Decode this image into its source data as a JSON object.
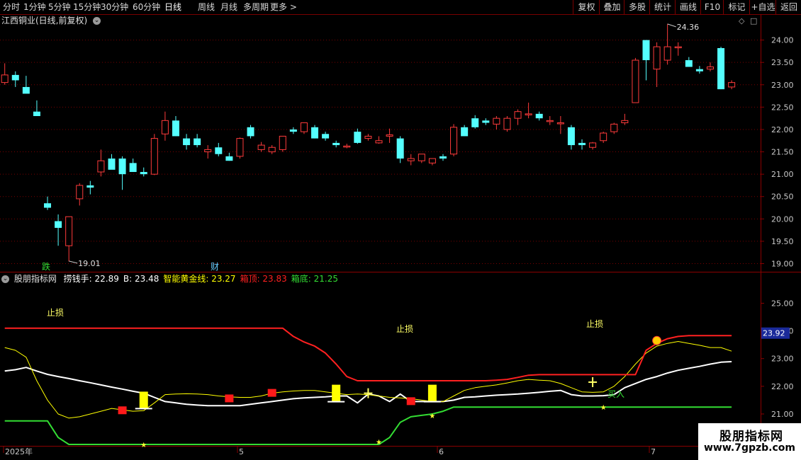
{
  "toolbar": {
    "periods": [
      "分时",
      "1分钟",
      "5分钟",
      "15分钟",
      "30分钟",
      "60分钟",
      "日线",
      "周线",
      "月线",
      "多周期",
      "更多 >"
    ],
    "active_period": "日线",
    "buttons": [
      "复权",
      "叠加",
      "多股",
      "统计",
      "画线",
      "F10",
      "标记",
      "+自选",
      "返回"
    ]
  },
  "main_panel": {
    "title": "江西铜业(日线,前复权)",
    "high_label": "24.36",
    "low_label": "19.01",
    "markers": [
      {
        "text": "跌",
        "color": "#33dd33"
      },
      {
        "text": "财",
        "color": "#66ccff"
      }
    ]
  },
  "indicator_panel": {
    "title": "股朋指标网",
    "legend": [
      {
        "label": "捞钱手:",
        "value": "22.89",
        "color": "#ffffff"
      },
      {
        "label": "B:",
        "value": "23.48",
        "color": "#ffffff"
      },
      {
        "label": "智能黄金线:",
        "value": "23.27",
        "color": "#ffff00"
      },
      {
        "label": "箱顶:",
        "value": "23.83",
        "color": "#ff2020"
      },
      {
        "label": "箱底:",
        "value": "21.25",
        "color": "#33dd33"
      }
    ],
    "annotations": [
      {
        "text": "止损",
        "color": "#ffff66"
      },
      {
        "text": "止损",
        "color": "#ffff66"
      },
      {
        "text": "止损",
        "color": "#ffff66"
      },
      {
        "text": "买入",
        "color": "#33dd33"
      }
    ],
    "current_value": "23.92"
  },
  "xaxis": {
    "labels": [
      "2025年",
      "5",
      "6",
      "7"
    ]
  },
  "watermark": {
    "line1": "股朋指标网",
    "line2": "www.7gpzb.com"
  },
  "chart_data": [
    {
      "type": "candlestick",
      "title": "江西铜业(日线,前复权)",
      "ylim": [
        18.85,
        24.5
      ],
      "yticks": [
        19.0,
        19.5,
        20.0,
        20.5,
        21.0,
        21.5,
        22.0,
        22.5,
        23.0,
        23.5,
        24.0
      ],
      "ohlc": [
        [
          23.05,
          23.48,
          23.0,
          23.22
        ],
        [
          23.22,
          23.3,
          22.95,
          23.1
        ],
        [
          22.95,
          23.2,
          22.9,
          22.8
        ],
        [
          22.4,
          22.65,
          22.3,
          22.3
        ],
        [
          20.35,
          20.5,
          20.2,
          20.25
        ],
        [
          19.95,
          20.1,
          19.4,
          19.8
        ],
        [
          19.4,
          20.05,
          19.05,
          20.05
        ],
        [
          20.45,
          20.8,
          20.3,
          20.75
        ],
        [
          20.75,
          20.85,
          20.55,
          20.7
        ],
        [
          21.05,
          21.55,
          20.95,
          21.3
        ],
        [
          21.35,
          21.45,
          21.15,
          21.1
        ],
        [
          21.35,
          21.4,
          20.65,
          21.0
        ],
        [
          21.25,
          21.35,
          21.05,
          21.05
        ],
        [
          21.05,
          21.15,
          20.95,
          21.0
        ],
        [
          21.0,
          21.9,
          20.98,
          21.8
        ],
        [
          21.9,
          22.4,
          21.75,
          22.2
        ],
        [
          22.2,
          22.3,
          21.85,
          21.85
        ],
        [
          21.8,
          21.9,
          21.55,
          21.65
        ],
        [
          21.8,
          21.9,
          21.6,
          21.65
        ],
        [
          21.5,
          21.65,
          21.35,
          21.55
        ],
        [
          21.6,
          21.7,
          21.4,
          21.45
        ],
        [
          21.4,
          21.48,
          21.3,
          21.3
        ],
        [
          21.4,
          21.82,
          21.35,
          21.8
        ],
        [
          22.05,
          22.1,
          21.8,
          21.85
        ],
        [
          21.55,
          21.72,
          21.5,
          21.65
        ],
        [
          21.5,
          21.65,
          21.45,
          21.6
        ],
        [
          21.55,
          21.85,
          21.5,
          21.85
        ],
        [
          22.0,
          22.05,
          21.9,
          21.95
        ],
        [
          21.95,
          22.15,
          21.9,
          22.15
        ],
        [
          22.05,
          22.1,
          21.8,
          21.8
        ],
        [
          21.9,
          21.95,
          21.75,
          21.8
        ],
        [
          21.7,
          21.75,
          21.6,
          21.65
        ],
        [
          21.62,
          21.68,
          21.58,
          21.63
        ],
        [
          21.95,
          22.02,
          21.68,
          21.7
        ],
        [
          21.8,
          21.9,
          21.75,
          21.85
        ],
        [
          21.7,
          21.85,
          21.68,
          21.75
        ],
        [
          21.85,
          22.02,
          21.7,
          21.88
        ],
        [
          21.8,
          21.85,
          21.25,
          21.35
        ],
        [
          21.3,
          21.45,
          21.2,
          21.35
        ],
        [
          21.3,
          21.45,
          21.25,
          21.45
        ],
        [
          21.25,
          21.35,
          21.2,
          21.35
        ],
        [
          21.4,
          21.45,
          21.3,
          21.35
        ],
        [
          21.45,
          22.12,
          21.4,
          22.05
        ],
        [
          22.05,
          22.1,
          21.85,
          21.85
        ],
        [
          22.25,
          22.32,
          22.02,
          22.05
        ],
        [
          22.2,
          22.25,
          22.1,
          22.15
        ],
        [
          22.12,
          22.3,
          22.0,
          22.25
        ],
        [
          22.0,
          22.3,
          21.95,
          22.25
        ],
        [
          22.25,
          22.45,
          22.1,
          22.4
        ],
        [
          22.35,
          22.6,
          22.25,
          22.35
        ],
        [
          22.35,
          22.4,
          22.2,
          22.25
        ],
        [
          22.2,
          22.3,
          22.1,
          22.2
        ],
        [
          22.15,
          22.3,
          21.9,
          22.15
        ],
        [
          22.05,
          22.1,
          21.55,
          21.65
        ],
        [
          21.7,
          21.78,
          21.55,
          21.65
        ],
        [
          21.6,
          21.72,
          21.55,
          21.7
        ],
        [
          21.75,
          21.95,
          21.7,
          21.92
        ],
        [
          21.95,
          22.15,
          21.9,
          22.12
        ],
        [
          22.15,
          22.35,
          22.1,
          22.2
        ],
        [
          22.6,
          23.6,
          22.6,
          23.55
        ],
        [
          24.0,
          24.0,
          23.1,
          23.55
        ],
        [
          23.35,
          23.95,
          22.95,
          23.85
        ],
        [
          23.55,
          24.36,
          23.45,
          23.85
        ],
        [
          23.85,
          23.95,
          23.65,
          23.85
        ],
        [
          23.55,
          23.62,
          23.4,
          23.4
        ],
        [
          23.35,
          23.42,
          23.25,
          23.3
        ],
        [
          23.35,
          23.5,
          23.3,
          23.4
        ],
        [
          23.82,
          23.85,
          22.9,
          22.9
        ],
        [
          22.95,
          23.1,
          22.9,
          23.05
        ]
      ]
    },
    {
      "type": "line",
      "title": "股朋指标网",
      "ylim": [
        19.9,
        25.6
      ],
      "yticks": [
        20.0,
        21.0,
        22.0,
        23.0,
        24.0,
        25.0
      ],
      "x": [
        0,
        1,
        2,
        3,
        4,
        5,
        6,
        7,
        8,
        9,
        10,
        11,
        12,
        13,
        14,
        15,
        16,
        17,
        18,
        19,
        20,
        21,
        22,
        23,
        24,
        25,
        26,
        27,
        28,
        29,
        30,
        31,
        32,
        33,
        34,
        35,
        36,
        37,
        38,
        39,
        40,
        41,
        42,
        43,
        44,
        45,
        46,
        47,
        48,
        49,
        50,
        51,
        52,
        53,
        54,
        55,
        56,
        57,
        58,
        59,
        60,
        61,
        62,
        63,
        64,
        65,
        66,
        67,
        68
      ],
      "series": [
        {
          "name": "捞钱手",
          "color": "#ffffff",
          "values": [
            22.55,
            22.6,
            22.68,
            22.55,
            22.43,
            22.35,
            22.28,
            22.2,
            22.13,
            22.05,
            21.97,
            21.9,
            21.82,
            21.75,
            21.6,
            21.45,
            21.4,
            21.35,
            21.32,
            21.3,
            21.3,
            21.3,
            21.3,
            21.35,
            21.4,
            21.45,
            21.5,
            21.55,
            21.58,
            21.6,
            21.62,
            21.65,
            21.65,
            21.4,
            21.72,
            21.65,
            21.45,
            21.72,
            21.45,
            21.45,
            21.45,
            21.45,
            21.5,
            21.6,
            21.62,
            21.65,
            21.68,
            21.7,
            21.72,
            21.75,
            21.78,
            21.82,
            21.85,
            21.7,
            21.65,
            21.65,
            21.66,
            21.7,
            21.95,
            22.1,
            22.25,
            22.35,
            22.48,
            22.58,
            22.65,
            22.72,
            22.8,
            22.87,
            22.89
          ]
        },
        {
          "name": "智能黄金线",
          "color": "#ffff00",
          "values": [
            23.4,
            23.3,
            23.05,
            22.2,
            21.5,
            21.0,
            20.85,
            20.9,
            21.0,
            21.1,
            21.2,
            21.15,
            21.1,
            21.12,
            21.4,
            21.7,
            21.72,
            21.73,
            21.72,
            21.7,
            21.65,
            21.62,
            21.6,
            21.6,
            21.65,
            21.75,
            21.8,
            21.83,
            21.85,
            21.85,
            21.8,
            21.75,
            21.7,
            21.72,
            21.7,
            21.65,
            21.6,
            21.58,
            21.55,
            21.5,
            21.45,
            21.45,
            21.65,
            21.85,
            21.95,
            22.0,
            22.05,
            22.12,
            22.2,
            22.25,
            22.22,
            22.2,
            22.1,
            21.95,
            21.8,
            21.78,
            21.8,
            22.0,
            22.35,
            22.8,
            23.2,
            23.45,
            23.55,
            23.62,
            23.55,
            23.48,
            23.4,
            23.4,
            23.27
          ]
        },
        {
          "name": "箱顶",
          "color": "#ff2020",
          "values": [
            24.1,
            24.1,
            24.1,
            24.1,
            24.1,
            24.1,
            24.1,
            24.1,
            24.1,
            24.1,
            24.1,
            24.1,
            24.1,
            24.1,
            24.1,
            24.1,
            24.1,
            24.1,
            24.1,
            24.1,
            24.1,
            24.1,
            24.1,
            24.1,
            24.1,
            24.1,
            24.1,
            23.8,
            23.6,
            23.45,
            23.2,
            22.8,
            22.35,
            22.2,
            22.2,
            22.2,
            22.2,
            22.2,
            22.2,
            22.2,
            22.2,
            22.2,
            22.2,
            22.2,
            22.2,
            22.2,
            22.22,
            22.25,
            22.32,
            22.4,
            22.42,
            22.42,
            22.42,
            22.42,
            22.42,
            22.42,
            22.42,
            22.42,
            22.42,
            22.42,
            23.3,
            23.55,
            23.72,
            23.8,
            23.83,
            23.83,
            23.83,
            23.83,
            23.83
          ]
        },
        {
          "name": "箱底",
          "color": "#33dd33",
          "values": [
            20.75,
            20.75,
            20.75,
            20.75,
            20.75,
            20.15,
            19.9,
            19.9,
            19.9,
            19.9,
            19.9,
            19.9,
            19.9,
            19.9,
            19.9,
            19.9,
            19.9,
            19.9,
            19.9,
            19.9,
            19.9,
            19.9,
            19.9,
            19.9,
            19.9,
            19.9,
            19.9,
            19.9,
            19.9,
            19.9,
            19.9,
            19.9,
            19.9,
            19.9,
            19.9,
            19.9,
            20.15,
            20.7,
            20.9,
            20.95,
            21.0,
            21.1,
            21.25,
            21.25,
            21.25,
            21.25,
            21.25,
            21.25,
            21.25,
            21.25,
            21.25,
            21.25,
            21.25,
            21.25,
            21.25,
            21.25,
            21.25,
            21.25,
            21.25,
            21.25,
            21.25,
            21.25,
            21.25,
            21.25,
            21.25,
            21.25,
            21.25,
            21.25,
            21.25
          ]
        }
      ],
      "signals": [
        {
          "x": 11,
          "y": 21.12,
          "kind": "red-square"
        },
        {
          "x": 13,
          "y": 21.5,
          "kind": "yellow-block"
        },
        {
          "x": 21,
          "y": 21.55,
          "kind": "red-square"
        },
        {
          "x": 25,
          "y": 21.75,
          "kind": "red-square"
        },
        {
          "x": 31,
          "y": 21.75,
          "kind": "yellow-block"
        },
        {
          "x": 34,
          "y": 21.75,
          "kind": "yellow-cross"
        },
        {
          "x": 38,
          "y": 21.45,
          "kind": "red-square"
        },
        {
          "x": 40,
          "y": 21.75,
          "kind": "yellow-block"
        },
        {
          "x": 55,
          "y": 22.15,
          "kind": "yellow-cross"
        },
        {
          "x": 13,
          "y": 19.9,
          "kind": "star"
        },
        {
          "x": 35,
          "y": 20.0,
          "kind": "star"
        },
        {
          "x": 40,
          "y": 20.95,
          "kind": "star"
        },
        {
          "x": 56,
          "y": 21.25,
          "kind": "star"
        },
        {
          "x": 61,
          "y": 23.65,
          "kind": "face"
        }
      ]
    }
  ]
}
